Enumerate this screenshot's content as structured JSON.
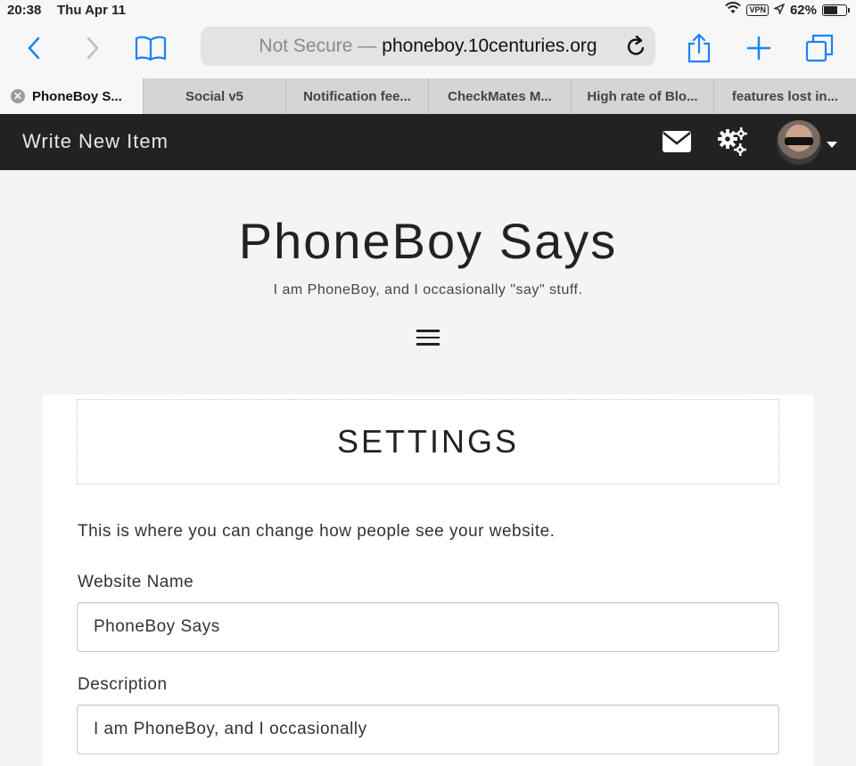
{
  "status": {
    "time": "20:38",
    "date": "Thu Apr 11",
    "vpn": "VPN",
    "battery": "62%",
    "battery_level": 0.62
  },
  "browser": {
    "address_prefix": "Not Secure —",
    "address_host": "phoneboy.10centuries.org",
    "accent": "#1a82fb"
  },
  "tabs": [
    {
      "label": "PhoneBoy S..."
    },
    {
      "label": "Social v5"
    },
    {
      "label": "Notification fee..."
    },
    {
      "label": "CheckMates M..."
    },
    {
      "label": "High rate of Blo..."
    },
    {
      "label": "features lost in..."
    }
  ],
  "sitebar": {
    "write_label": "Write New Item"
  },
  "site": {
    "title": "PhoneBoy Says",
    "tagline": "I am PhoneBoy, and I occasionally \"say\" stuff."
  },
  "settings": {
    "heading": "SETTINGS",
    "intro": "This is where you can change how people see your website.",
    "website_name_label": "Website Name",
    "website_name_value": "PhoneBoy Says",
    "description_label": "Description",
    "description_value": "I am PhoneBoy, and I occasionally"
  }
}
